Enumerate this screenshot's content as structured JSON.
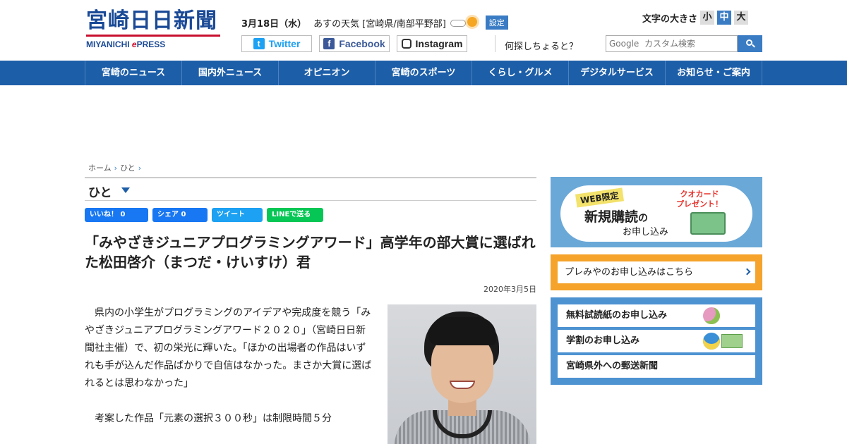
{
  "header": {
    "logo_main": "宮崎日日新聞",
    "logo_sub_prefix": "MIYANICHI ",
    "logo_sub_e": "e",
    "logo_sub_suffix": "PRESS",
    "date": "3月18日（水）",
    "weather_label": "あすの天気 [宮崎県/南部平野部]",
    "settings_label": "設定",
    "ask_label": "何探しちょると？",
    "fontsize_label": "文字の大きさ",
    "fontsize_options": [
      "小",
      "中",
      "大"
    ],
    "fontsize_selected": "中",
    "search_placeholder": "Google  カスタム検索"
  },
  "social": {
    "twitter": "Twitter",
    "facebook": "Facebook",
    "instagram": "Instagram"
  },
  "nav": [
    "宮崎のニュース",
    "国内外ニュース",
    "オピニオン",
    "宮崎のスポーツ",
    "くらし・グルメ",
    "デジタルサービス",
    "お知らせ・ご案内"
  ],
  "breadcrumb": [
    "ホーム",
    "ひと"
  ],
  "section_title": "ひと",
  "share": {
    "like": "いいね！ 0",
    "fb_share": "シェア 0",
    "tweet": "ツイート",
    "line": "LINEで送る"
  },
  "article": {
    "headline": "「みやざきジュニアプログラミングアワード」高学年の部大賞に選ばれた松田啓介（まつだ・けいすけ）君",
    "date": "2020年3月5日",
    "paragraphs": [
      "県内の小学生がプログラミングのアイデアや完成度を競う「みやざきジュニアプログラミングアワード２０２０」（宮崎日日新聞社主催）で、初の栄光に輝いた。「ほかの出場者の作品はいずれも手が込んだ作品ばかりで自信はなかった。まさか大賞に選ばれるとは思わなかった」",
      "考案した作品「元素の選択３００秒」は制限時間５分"
    ]
  },
  "sidebar": {
    "promo_web": "WEB限定",
    "promo_main": "新規購読",
    "promo_no": "の",
    "promo_sub": "お申し込み",
    "promo_quo": "クオカード",
    "promo_present": "プレゼント！",
    "premiya": "プレみやのお申し込みはこちら",
    "items": [
      "無料試読紙のお申し込み",
      "学割のお申し込み",
      "宮崎県外への郵送新聞"
    ]
  },
  "colors": {
    "brand_blue": "#1d5ea8",
    "accent_red": "#c8102e",
    "orange": "#f5a32a"
  }
}
